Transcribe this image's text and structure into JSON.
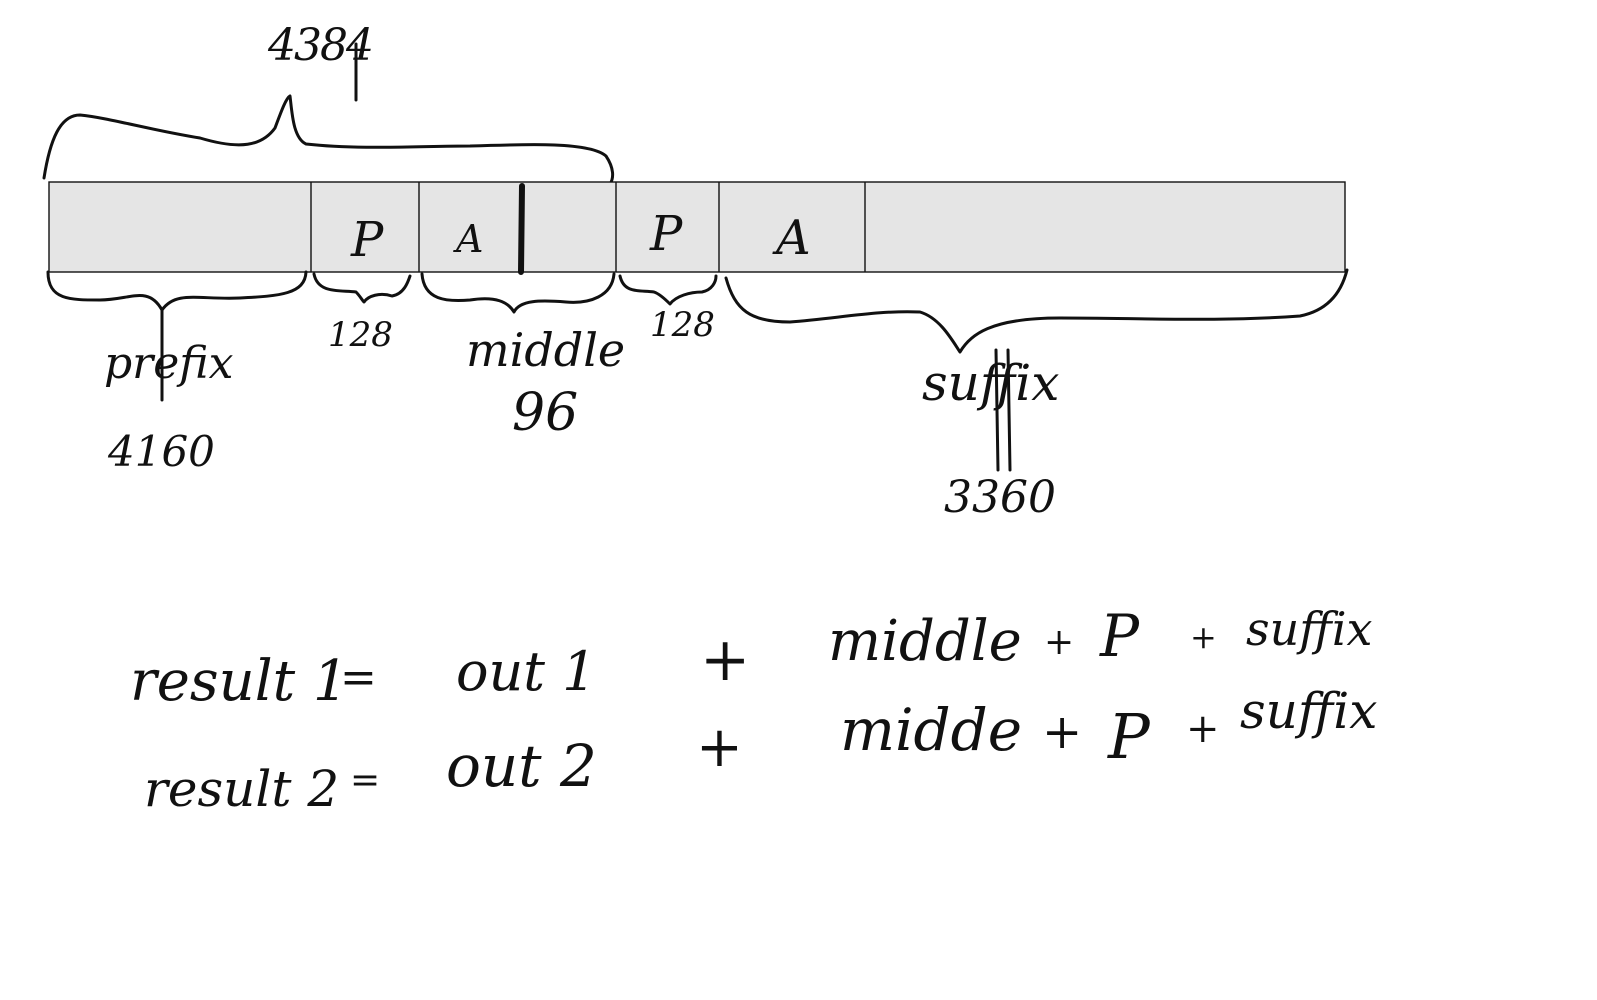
{
  "colors": {
    "ink": "#111111",
    "bar_fill": "#e5e5e5",
    "background": "#ffffff"
  },
  "top_label": "4384",
  "bar_segments": [
    {
      "name": "prefix",
      "text": ""
    },
    {
      "name": "p1",
      "text": "P"
    },
    {
      "name": "a1",
      "text": "A"
    },
    {
      "name": "p2",
      "text": "P"
    },
    {
      "name": "a2",
      "text": "A"
    },
    {
      "name": "rest",
      "text": ""
    }
  ],
  "labels": {
    "prefix": "prefix",
    "prefix_size": "4160",
    "p1_size": "128",
    "middle": "middle",
    "middle_size": "96",
    "p2_size": "128",
    "suffix": "suffix",
    "suffix_size": "3360"
  },
  "equations": [
    {
      "lhs": "result 1",
      "eq": "=",
      "out": "out 1",
      "plus1": "+",
      "mid": "middle",
      "plus2": "+",
      "p": "P",
      "plus3": "+",
      "suffix": "suffix"
    },
    {
      "lhs": "result 2",
      "eq": "=",
      "out": "out 2",
      "plus1": "+",
      "mid": "midde",
      "plus2": "+",
      "p": "P",
      "plus3": "+",
      "suffix": "suffix"
    }
  ]
}
